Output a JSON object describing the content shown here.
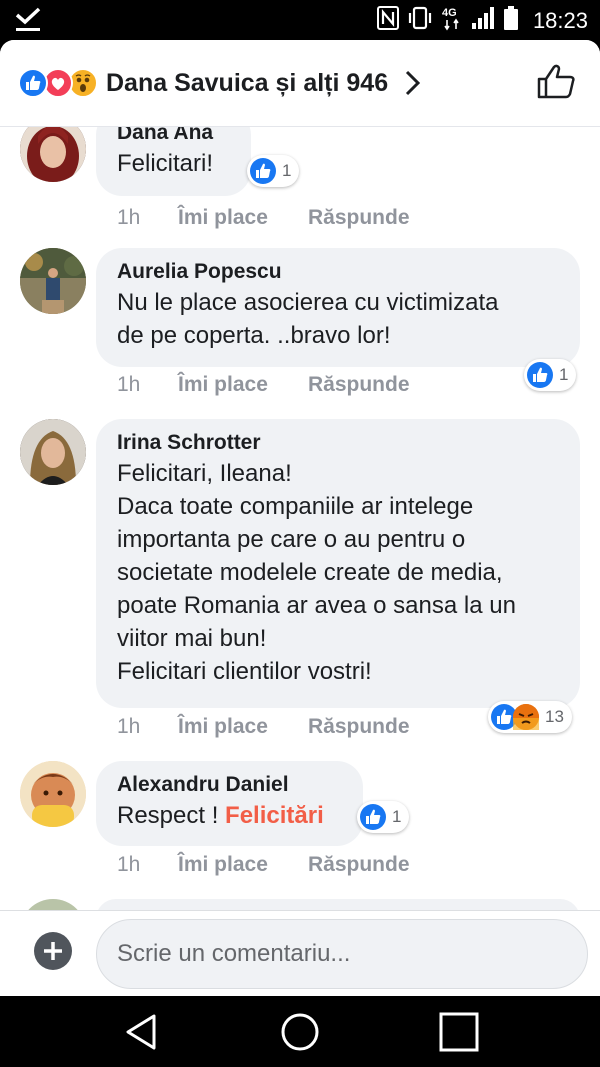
{
  "status_bar": {
    "time": "18:23",
    "network": "4G",
    "icons": [
      "check-notification-icon",
      "nfc-icon",
      "vibrate-icon",
      "signal-icon",
      "battery-icon"
    ]
  },
  "header": {
    "reactors_title": "Dana Savuica și alți 946",
    "reaction_icons": [
      "like-icon",
      "love-icon",
      "wow-icon"
    ]
  },
  "comments": [
    {
      "author": "Dana Ana",
      "lines": [
        "Felicitari!"
      ],
      "time": "1h",
      "like_label": "Îmi place",
      "reply_label": "Răspunde",
      "reaction_count": "1",
      "reactions": [
        "like-icon"
      ]
    },
    {
      "author": "Aurelia Popescu",
      "lines": [
        "Nu le place asocierea cu victimizata",
        "de pe coperta. ..bravo lor!"
      ],
      "time": "1h",
      "like_label": "Îmi place",
      "reply_label": "Răspunde",
      "reaction_count": "1",
      "reactions": [
        "like-icon"
      ]
    },
    {
      "author": "Irina Schrotter",
      "lines": [
        "Felicitari, Ileana!",
        "Daca toate companiile ar intelege",
        "importanta pe care o au pentru o",
        "societate modelele create de media,",
        "poate Romania ar avea o sansa la un",
        "viitor mai bun!",
        "Felicitari clientilor vostri!"
      ],
      "time": "1h",
      "like_label": "Îmi place",
      "reply_label": "Răspunde",
      "reaction_count": "13",
      "reactions": [
        "like-icon",
        "angry-icon"
      ]
    },
    {
      "author": "Alexandru Daniel",
      "text_plain": "Respect ! ",
      "text_highlight": "Felicitări",
      "time": "1h",
      "like_label": "Îmi place",
      "reply_label": "Răspunde",
      "reaction_count": "1",
      "reactions": [
        "like-icon"
      ]
    }
  ],
  "composer": {
    "placeholder": "Scrie un comentariu..."
  },
  "colors": {
    "facebook_blue": "#1877f2",
    "love_red": "#f33e58",
    "wow_yellow": "#f7b125",
    "highlight_text": "#f25e47",
    "bubble_bg": "#f0f2f5"
  }
}
